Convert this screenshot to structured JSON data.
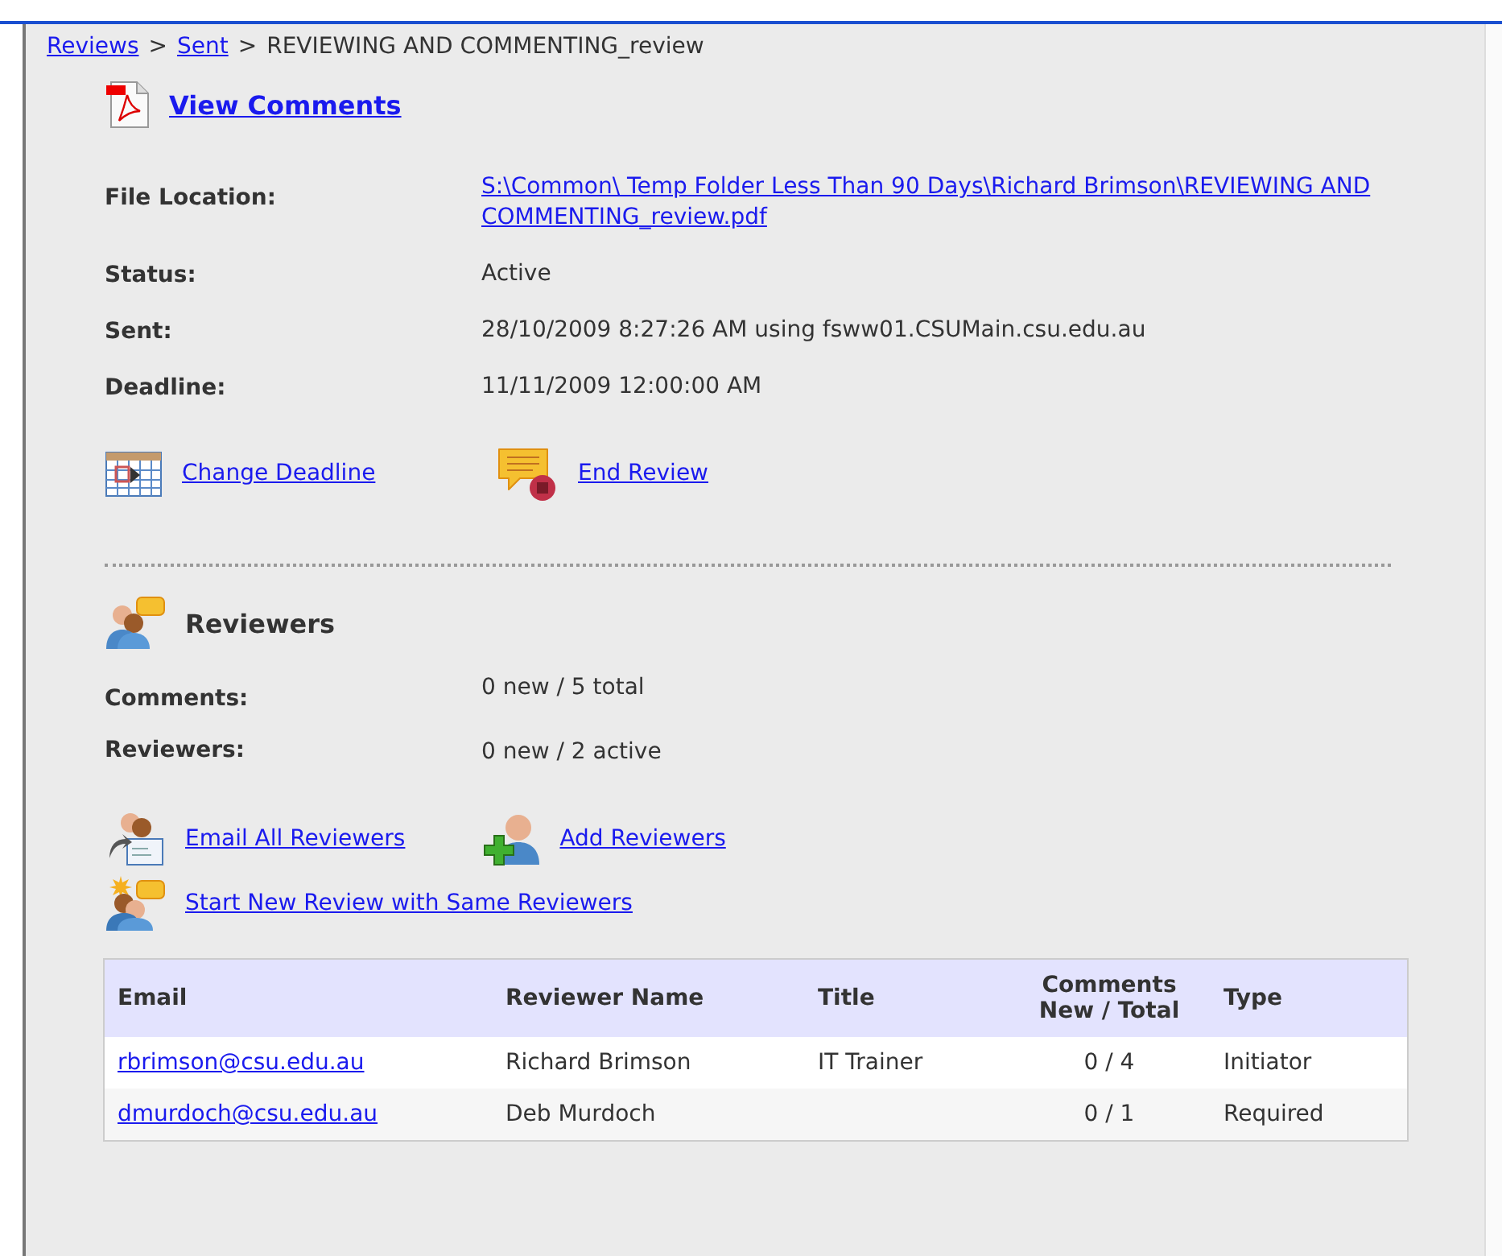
{
  "breadcrumb": [
    {
      "text": "Reviews",
      "kind": "link"
    },
    {
      "text": ">",
      "kind": "separator"
    },
    {
      "text": "Sent",
      "kind": "link"
    },
    {
      "text": ">",
      "kind": "separator"
    },
    {
      "text": "REVIEWING AND COMMENTING_review",
      "kind": "current"
    }
  ],
  "view_comments": {
    "label": "View Comments"
  },
  "details": [
    {
      "label": "File Location:",
      "value": "S:\\Common\\ Temp Folder Less Than 90 Days\\Richard Brimson\\REVIEWING AND COMMENTING_review.pdf",
      "kind": "link"
    },
    {
      "label": "Status:",
      "value": "Active",
      "kind": "text"
    },
    {
      "label": "Sent:",
      "value": "28/10/2009 8:27:26 AM using fsww01.CSUMain.csu.edu.au",
      "kind": "text"
    },
    {
      "label": "Deadline:",
      "value": "11/11/2009 12:00:00 AM",
      "kind": "text"
    }
  ],
  "review_actions": [
    {
      "label": "Change Deadline",
      "kind": "calendar"
    },
    {
      "label": "End Review",
      "kind": "stop"
    }
  ],
  "reviewers": {
    "title": "Reviewers",
    "stats": [
      {
        "label": "Comments:",
        "value": "0 new / 5 total"
      },
      {
        "label": "Reviewers:",
        "value": "0 new / 2 active"
      }
    ],
    "actions": [
      [
        {
          "label": "Email All Reviewers",
          "kind": "email"
        },
        {
          "label": "Add Reviewers",
          "kind": "add"
        }
      ],
      [
        {
          "label": "Start New Review with Same Reviewers",
          "kind": "new"
        }
      ]
    ],
    "table": {
      "columns": [
        "Email",
        "Reviewer Name",
        "Title",
        "Comments New / Total",
        "Type"
      ],
      "rows": [
        [
          "rbrimson@csu.edu.au",
          "Richard Brimson",
          "IT Trainer",
          "0 / 4",
          "Initiator"
        ],
        [
          "dmurdoch@csu.edu.au",
          "Deb Murdoch",
          "",
          "0 / 1",
          "Required"
        ]
      ]
    }
  }
}
